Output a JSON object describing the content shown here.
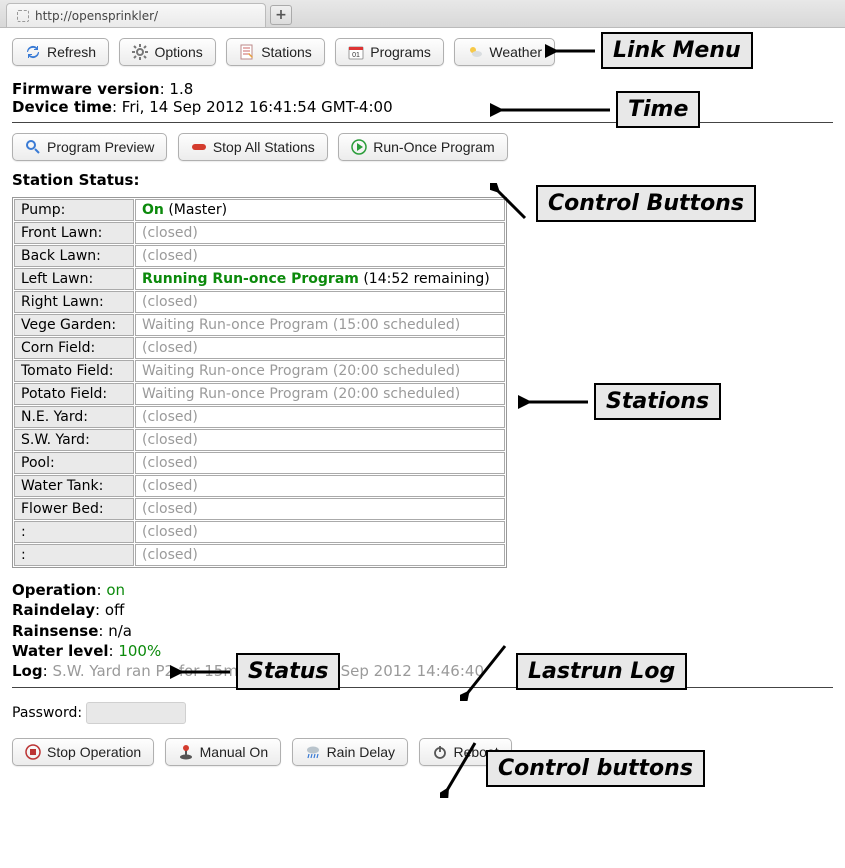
{
  "browser": {
    "url": "http://opensprinkler/"
  },
  "toolbar": {
    "refresh": "Refresh",
    "options": "Options",
    "stations": "Stations",
    "programs": "Programs",
    "weather": "Weather"
  },
  "info": {
    "firmware_label": "Firmware version",
    "firmware_value": "1.8",
    "time_label": "Device time",
    "time_value": "Fri, 14 Sep 2012 16:41:54 GMT-4:00"
  },
  "controls": {
    "preview": "Program Preview",
    "stop_all": "Stop All Stations",
    "run_once": "Run-Once Program"
  },
  "station_header": "Station Status:",
  "stations": [
    {
      "name": "Pump:",
      "status_type": "on_master",
      "on": "On",
      "suffix": " (Master)"
    },
    {
      "name": "Front Lawn:",
      "status_type": "closed",
      "text": "(closed)"
    },
    {
      "name": "Back Lawn:",
      "status_type": "closed",
      "text": "(closed)"
    },
    {
      "name": "Left Lawn:",
      "status_type": "running",
      "running": "Running Run-once Program",
      "suffix": " (14:52 remaining)"
    },
    {
      "name": "Right Lawn:",
      "status_type": "closed",
      "text": "(closed)"
    },
    {
      "name": "Vege Garden:",
      "status_type": "waiting",
      "text": "Waiting Run-once Program (15:00 scheduled)"
    },
    {
      "name": "Corn Field:",
      "status_type": "closed",
      "text": "(closed)"
    },
    {
      "name": "Tomato Field:",
      "status_type": "waiting",
      "text": "Waiting Run-once Program (20:00 scheduled)"
    },
    {
      "name": "Potato Field:",
      "status_type": "waiting",
      "text": "Waiting Run-once Program (20:00 scheduled)"
    },
    {
      "name": "N.E. Yard:",
      "status_type": "closed",
      "text": "(closed)"
    },
    {
      "name": "S.W. Yard:",
      "status_type": "closed",
      "text": "(closed)"
    },
    {
      "name": "Pool:",
      "status_type": "closed",
      "text": "(closed)"
    },
    {
      "name": "Water Tank:",
      "status_type": "closed",
      "text": "(closed)"
    },
    {
      "name": "Flower Bed:",
      "status_type": "closed",
      "text": "(closed)"
    },
    {
      "name": ":",
      "status_type": "closed",
      "text": "(closed)"
    },
    {
      "name": ":",
      "status_type": "closed",
      "text": "(closed)"
    }
  ],
  "status": {
    "operation_label": "Operation",
    "operation_value": "on",
    "raindelay_label": "Raindelay",
    "raindelay_value": "off",
    "rainsense_label": "Rainsense",
    "rainsense_value": "n/a",
    "waterlevel_label": "Water level",
    "waterlevel_value": "100%",
    "log_label": "Log",
    "log_value": "S.W. Yard ran P2 for 15m45s @ Fri, 14 Sep 2012 14:46:40"
  },
  "password_label": "Password:",
  "bottom": {
    "stop_op": "Stop Operation",
    "manual_on": "Manual On",
    "rain_delay": "Rain Delay",
    "reboot": "Reboot"
  },
  "annotations": {
    "link_menu": "Link Menu",
    "time": "Time",
    "control_buttons": "Control Buttons",
    "stations": "Stations",
    "status": "Status",
    "lastrun": "Lastrun Log",
    "control_buttons2": "Control buttons"
  }
}
